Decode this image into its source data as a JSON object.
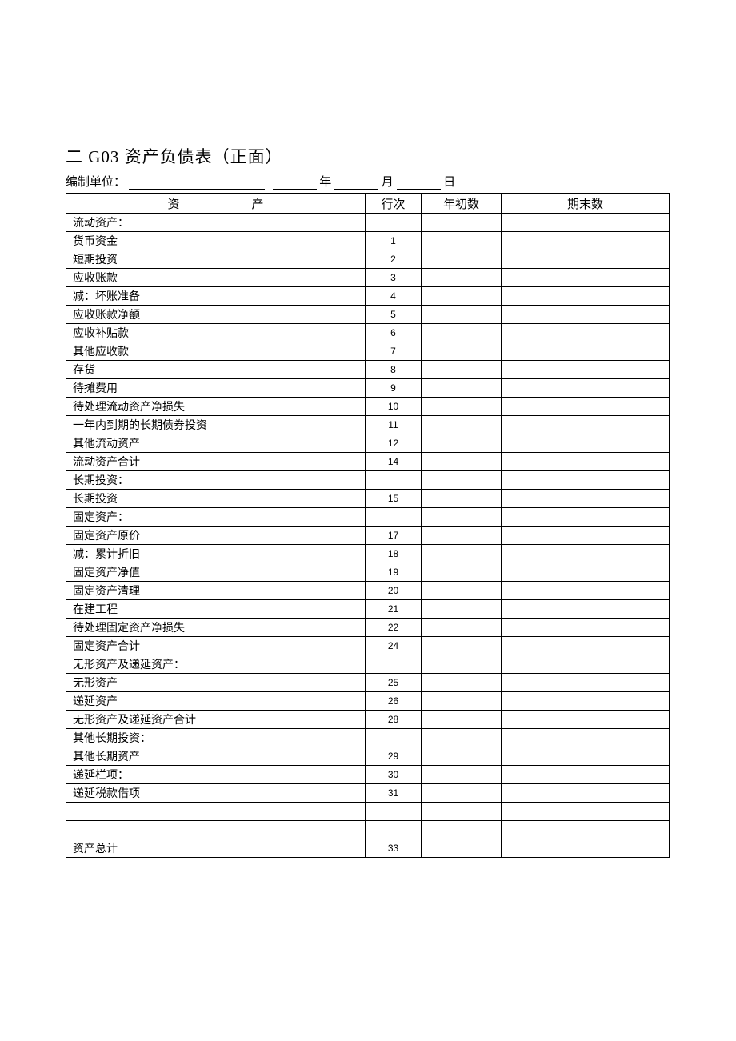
{
  "title": "二 G03 资产负债表（正面）",
  "subtitle": {
    "unit_label": "编制单位：",
    "year_label": "年",
    "month_label": "月",
    "day_label": "日"
  },
  "headers": {
    "asset_a": "资",
    "asset_b": "产",
    "row_no": "行次",
    "begin": "年初数",
    "end": "期末数"
  },
  "rows": [
    {
      "name": "流动资产：",
      "indent": 1,
      "row": ""
    },
    {
      "name": "货币资金",
      "indent": 2,
      "row": "1"
    },
    {
      "name": "短期投资",
      "indent": 2,
      "row": "2"
    },
    {
      "name": "应收账款",
      "indent": 2,
      "row": "3"
    },
    {
      "name": "减：坏账准备",
      "indent": 3,
      "row": "4"
    },
    {
      "name": "应收账款净额",
      "indent": 2,
      "row": "5"
    },
    {
      "name": "应收补贴款",
      "indent": 2,
      "row": "6"
    },
    {
      "name": "其他应收款",
      "indent": 2,
      "row": "7"
    },
    {
      "name": "存货",
      "indent": 2,
      "row": "8"
    },
    {
      "name": "待摊费用",
      "indent": 2,
      "row": "9"
    },
    {
      "name": "待处理流动资产净损失",
      "indent": 2,
      "row": "10"
    },
    {
      "name": "一年内到期的长期债券投资",
      "indent": 3,
      "row": "11"
    },
    {
      "name": "其他流动资产",
      "indent": 2,
      "row": "12"
    },
    {
      "name": "流动资产合计",
      "indent": 3,
      "row": "14"
    },
    {
      "name": "长期投资：",
      "indent": 1,
      "row": ""
    },
    {
      "name": "长期投资",
      "indent": 2,
      "row": "15"
    },
    {
      "name": "固定资产：",
      "indent": 1,
      "row": ""
    },
    {
      "name": "固定资产原价",
      "indent": 2,
      "row": "17"
    },
    {
      "name": "减：累计折旧",
      "indent": 3,
      "row": "18"
    },
    {
      "name": "固定资产净值",
      "indent": 2,
      "row": "19"
    },
    {
      "name": "固定资产清理",
      "indent": 2,
      "row": "20"
    },
    {
      "name": "在建工程",
      "indent": 2,
      "row": "21"
    },
    {
      "name": "待处理固定资产净损失",
      "indent": 2,
      "row": "22"
    },
    {
      "name": "固定资产合计",
      "indent": 3,
      "row": "24"
    },
    {
      "name": "无形资产及递延资产：",
      "indent": 1,
      "row": ""
    },
    {
      "name": "无形资产",
      "indent": 2,
      "row": "25"
    },
    {
      "name": "递延资产",
      "indent": 2,
      "row": "26"
    },
    {
      "name": "无形资产及递延资产合计",
      "indent": 3,
      "row": "28"
    },
    {
      "name": "其他长期投资：",
      "indent": 1,
      "row": ""
    },
    {
      "name": "其他长期资产",
      "indent": 2,
      "row": "29"
    },
    {
      "name": "递延栏项：",
      "indent": 1,
      "row": "30"
    },
    {
      "name": "递延税款借项",
      "indent": 2,
      "row": "31"
    },
    {
      "name": "",
      "indent": 1,
      "row": ""
    },
    {
      "name": "",
      "indent": 1,
      "row": ""
    },
    {
      "name": "资产总计",
      "indent": 2,
      "row": "33"
    }
  ],
  "chart_data": {
    "type": "table",
    "title": "二 G03 资产负债表（正面）",
    "columns": [
      "资产",
      "行次",
      "年初数",
      "期末数"
    ],
    "rows": [
      [
        "流动资产：",
        "",
        "",
        ""
      ],
      [
        "货币资金",
        "1",
        "",
        ""
      ],
      [
        "短期投资",
        "2",
        "",
        ""
      ],
      [
        "应收账款",
        "3",
        "",
        ""
      ],
      [
        "减：坏账准备",
        "4",
        "",
        ""
      ],
      [
        "应收账款净额",
        "5",
        "",
        ""
      ],
      [
        "应收补贴款",
        "6",
        "",
        ""
      ],
      [
        "其他应收款",
        "7",
        "",
        ""
      ],
      [
        "存货",
        "8",
        "",
        ""
      ],
      [
        "待摊费用",
        "9",
        "",
        ""
      ],
      [
        "待处理流动资产净损失",
        "10",
        "",
        ""
      ],
      [
        "一年内到期的长期债券投资",
        "11",
        "",
        ""
      ],
      [
        "其他流动资产",
        "12",
        "",
        ""
      ],
      [
        "流动资产合计",
        "14",
        "",
        ""
      ],
      [
        "长期投资：",
        "",
        "",
        ""
      ],
      [
        "长期投资",
        "15",
        "",
        ""
      ],
      [
        "固定资产：",
        "",
        "",
        ""
      ],
      [
        "固定资产原价",
        "17",
        "",
        ""
      ],
      [
        "减：累计折旧",
        "18",
        "",
        ""
      ],
      [
        "固定资产净值",
        "19",
        "",
        ""
      ],
      [
        "固定资产清理",
        "20",
        "",
        ""
      ],
      [
        "在建工程",
        "21",
        "",
        ""
      ],
      [
        "待处理固定资产净损失",
        "22",
        "",
        ""
      ],
      [
        "固定资产合计",
        "24",
        "",
        ""
      ],
      [
        "无形资产及递延资产：",
        "",
        "",
        ""
      ],
      [
        "无形资产",
        "25",
        "",
        ""
      ],
      [
        "递延资产",
        "26",
        "",
        ""
      ],
      [
        "无形资产及递延资产合计",
        "28",
        "",
        ""
      ],
      [
        "其他长期投资：",
        "",
        "",
        ""
      ],
      [
        "其他长期资产",
        "29",
        "",
        ""
      ],
      [
        "递延栏项：",
        "30",
        "",
        ""
      ],
      [
        "递延税款借项",
        "31",
        "",
        ""
      ],
      [
        "",
        "",
        "",
        ""
      ],
      [
        "",
        "",
        "",
        ""
      ],
      [
        "资产总计",
        "33",
        "",
        ""
      ]
    ]
  }
}
